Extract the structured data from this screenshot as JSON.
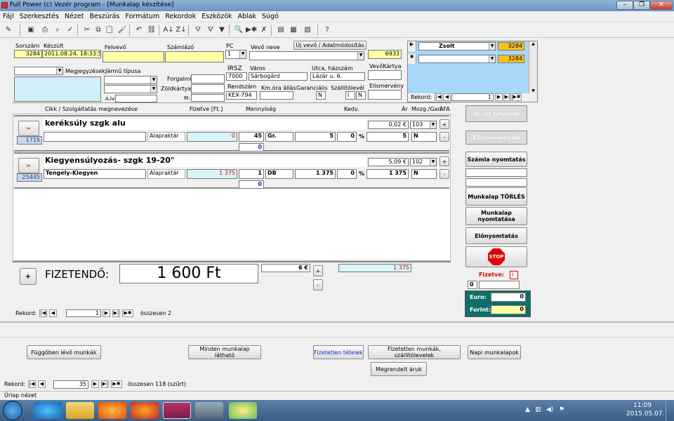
{
  "window": {
    "title": "Full Power (c) Vezér program - [Munkalap készítése]"
  },
  "menu": [
    "Fájl",
    "Szerkesztés",
    "Nézet",
    "Beszúrás",
    "Formátum",
    "Rekordok",
    "Eszközök",
    "Ablak",
    "Súgó"
  ],
  "header": {
    "sorszam_label": "Sorszám",
    "sorszam": "3284",
    "keszult_label": "Készült",
    "keszult": "2011.08.24. 18:33:58",
    "felvevo_label": "Felvevő",
    "szamlazo_label": "Számlázó",
    "pc_label": "PC",
    "pc": "1",
    "vevo_neve_label": "Vevő neve",
    "uj_vevo_button": "Új vevő / Adatmódosítás",
    "vevo_code": "6933",
    "vevokartya_label": "VevőKártya",
    "megjegyzesek_label": "Megjegyzések",
    "jarmu_tipusa_label": "Jármű típusa",
    "forgalmi_label": "Forgalmi:",
    "zoldkartya_label": "Zöldkártya:",
    "m_label": "M:",
    "alv_label": "A.lv:",
    "irsz_label": "IRSZ",
    "irsz": "7000",
    "varos_label": "Város",
    "varos": "Sárbogárd",
    "utca_label": "Utca, házszám",
    "utca": "Lázár u. 6.",
    "rendszam_label": "Rendszám",
    "rendszam": "KEX-794",
    "kmora_label": "Km.óra állás",
    "garancialis_label": "Garanciális",
    "garancialis": "N",
    "szallitolevel_label": "Szállítólevél",
    "szallitolevel_1": "I",
    "szallitolevel_2": "N",
    "elismerveny_label": "Elismervény"
  },
  "users": {
    "rows": [
      {
        "marker": "▶",
        "name": "Zsolt",
        "num": "3284"
      },
      {
        "marker": "✱",
        "name": "",
        "num": "3284"
      }
    ],
    "rekord_label": "Rekord:",
    "rekord_value": "1"
  },
  "columns": {
    "cikk": "Cikk / Szolgáltatás megnevezése",
    "fizetve": "Fizetve [Ft.]",
    "mennyiseg": "Mennyiség",
    "kedv": "Kedv.",
    "ar": "Ár",
    "mozg": "Mozg./Gari",
    "afa": "ÁFA"
  },
  "items": [
    {
      "title": "keréksúly szgk alu",
      "code": "1715",
      "price_eur": "0,02 €",
      "mozg": "103",
      "sub_name": "",
      "alapraktar": "Alapraktár",
      "fizetve": "0",
      "qty": "45",
      "unit": "Gr.",
      "unit_price": "5",
      "kedv": "0",
      "pct": "%",
      "ar": "5",
      "afa": "N",
      "extra": "0"
    },
    {
      "title": "Kiegyensúlyozás- szgk 19-20\"",
      "code": "25445",
      "price_eur": "5,09 €",
      "mozg": "102",
      "sub_name": "Tengely-Kiegyen",
      "alapraktar": "Alapraktár",
      "fizetve": "1 375",
      "qty": "1",
      "unit": "DB",
      "unit_price": "1 375",
      "kedv": "0",
      "pct": "%",
      "ar": "1 375",
      "afa": "N",
      "extra": "0"
    }
  ],
  "totals": {
    "fizetendo_label": "FIZETENDŐ:",
    "amount": "1 600 Ft",
    "eur": "6 €",
    "paid": "1 375",
    "plus_label": "+",
    "minus_label": "-",
    "add_row_label": "+"
  },
  "item_nav": {
    "rekord_label": "Rekord:",
    "value": "1",
    "osszesen": "összesen 2"
  },
  "side_buttons": {
    "uj_sor": "Új sor felvitele",
    "elismervenyrol": "Elismervényről",
    "szamla": "Számla nyomtatás",
    "torles": "Munkalap TÖRLÉS",
    "nyomtatas": "Munkalap nyomtatása",
    "elonyomtatas": "Előnyomtatás",
    "stop": "STOP"
  },
  "payment": {
    "fizetve_label": "Fizetve:",
    "fizetve_value": "I",
    "zero": "0",
    "euro_label": "Euro:",
    "euro": "0",
    "forint_label": "Forint:",
    "forint": "0"
  },
  "bottom_buttons": [
    "Függőben lévő munkák",
    "Minden munkalap látható",
    "Fizetetlen tételek",
    "Fizetetlen munkák, szállítólevelek",
    "Napi munkalapok",
    "Megrendelt áruk"
  ],
  "bottom_nav": {
    "rekord_label": "Rekord:",
    "value": "35",
    "osszesen": "összesen 118 (szűrt)"
  },
  "status": "Űrlap nézet",
  "clock": {
    "time": "11:09",
    "date": "2015.05.07."
  },
  "colors": {
    "yellow": "#ffffa8",
    "cyan": "#d8f4fa",
    "teal": "#0f6e6a",
    "red": "#e00000",
    "blue_panel": "#a8d8f8"
  }
}
